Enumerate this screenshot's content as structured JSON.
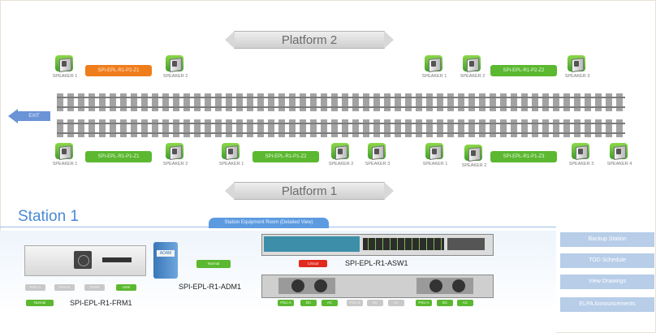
{
  "platforms": {
    "top": "Platform 2",
    "bottom": "Platform 1"
  },
  "exit_label": "EXIT",
  "top_speakers": [
    {
      "label": "SPEAKER 1"
    },
    {
      "label": "SPEAKER 2"
    },
    {
      "label": "SPEAKER 1"
    },
    {
      "label": "SPEAKER 2"
    },
    {
      "label": "SPEAKER 3"
    }
  ],
  "bottom_speakers": [
    {
      "label": "SPEAKER 1"
    },
    {
      "label": "SPEAKER 2"
    },
    {
      "label": "SPEAKER 1"
    },
    {
      "label": "SPEAKER 2"
    },
    {
      "label": "SPEAKER 3"
    },
    {
      "label": "SPEAKER 1"
    },
    {
      "label": "SPEAKER 2"
    },
    {
      "label": "SPEAKER 3"
    },
    {
      "label": "SPEAKER 4"
    }
  ],
  "top_zones": [
    {
      "label": "SPI-EPL-R1-P2-Z1",
      "status": "orange"
    },
    {
      "label": "SPI-EPL-R1-P2-Z2",
      "status": "green"
    }
  ],
  "bottom_zones": [
    {
      "label": "SPI-EPL-R1-P1-Z1",
      "status": "green"
    },
    {
      "label": "SPI-EPL-R1-P1-Z2",
      "status": "green"
    },
    {
      "label": "SPI-EPL-R1-P1-Z3",
      "status": "green"
    }
  ],
  "station": {
    "title": "Station 1",
    "tab": "Station Equipment Room (Detailed View)"
  },
  "devices": {
    "frm": {
      "name": "SPI-EPL-R1-FRM1",
      "status": "Normal",
      "ports": [
        "PSU A",
        "PSU B",
        "TEMP",
        "LINK"
      ]
    },
    "adm": {
      "name": "SPI-EPL-R1-ADM1",
      "status": "Normal"
    },
    "asw": {
      "name": "SPI-EPL-R1-ASW1",
      "status": "Critical"
    },
    "ps_ports": [
      "PSU A",
      "DC",
      "AC",
      "PSU B",
      "DC",
      "AC",
      "PSU A",
      "DC",
      "AC"
    ]
  },
  "side_buttons": [
    "Backup Station",
    "TOD Schedule",
    "View Drawings",
    "ELPA Announcements"
  ],
  "colors": {
    "accent": "#4a89d6",
    "ok": "#5bb830",
    "warn": "#f07d1c",
    "critical": "#e02a1f"
  }
}
